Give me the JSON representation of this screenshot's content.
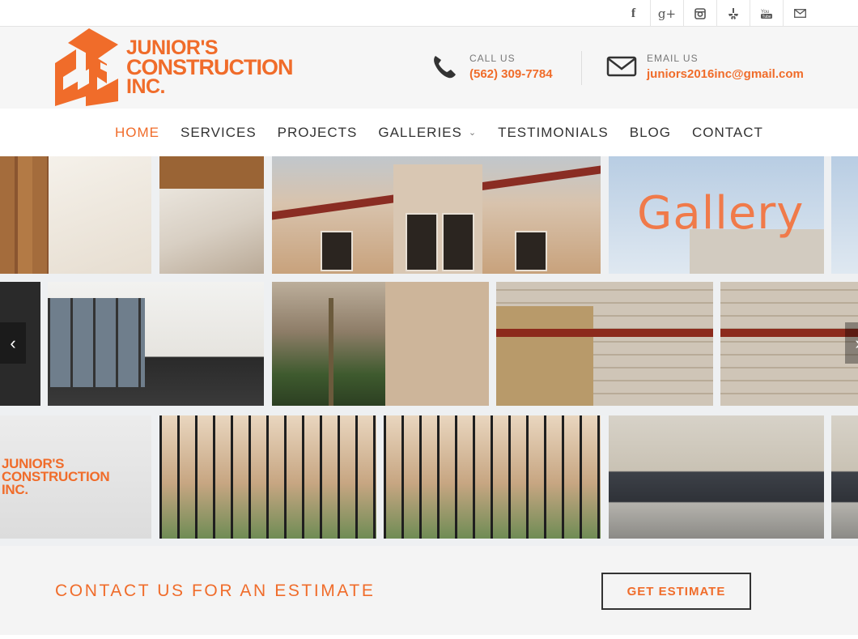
{
  "social": {
    "icons": [
      {
        "name": "facebook-icon",
        "glyph": "f"
      },
      {
        "name": "google-plus-icon",
        "glyph": "g+"
      },
      {
        "name": "instagram-icon",
        "glyph": "◘"
      },
      {
        "name": "yelp-icon",
        "glyph": "✻"
      },
      {
        "name": "youtube-icon",
        "glyph": "You"
      },
      {
        "name": "email-icon",
        "glyph": "✉"
      }
    ]
  },
  "header": {
    "logo": {
      "line1": "JUNIOR'S",
      "line2": "CONSTRUCTION",
      "line3": "INC."
    },
    "call": {
      "label": "CALL US",
      "value": "(562) 309-7784"
    },
    "email": {
      "label": "EMAIL US",
      "value": "juniors2016inc@gmail.com"
    }
  },
  "nav": {
    "items": [
      {
        "label": "HOME",
        "active": true
      },
      {
        "label": "SERVICES"
      },
      {
        "label": "PROJECTS"
      },
      {
        "label": "GALLERIES",
        "dropdown": true
      },
      {
        "label": "TESTIMONIALS"
      },
      {
        "label": "BLOG"
      },
      {
        "label": "CONTACT"
      }
    ]
  },
  "hero": {
    "overlay_text": "Gallery",
    "logo": {
      "line1": "JUNIOR'S",
      "line2": "CONSTRUCTION",
      "line3": "INC."
    }
  },
  "estimate": {
    "text": "CONTACT US FOR AN ESTIMATE",
    "button": "GET ESTIMATE"
  },
  "colors": {
    "accent": "#f06c2a",
    "header_bg": "#f6f6f6",
    "band_bg": "#f4f4f4"
  }
}
